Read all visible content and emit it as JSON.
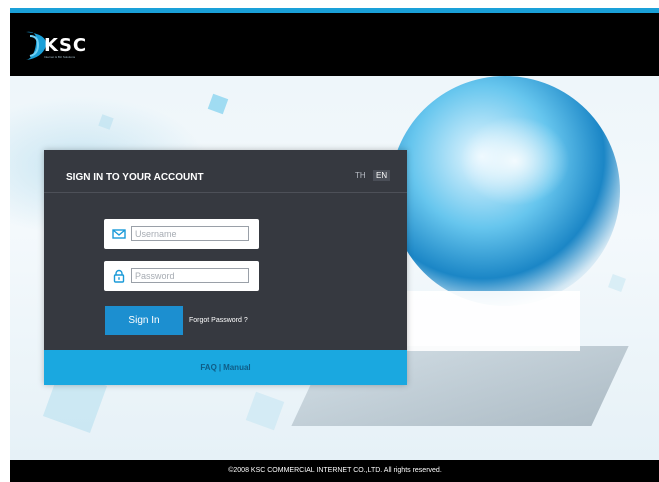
{
  "brand": {
    "logo_text": "KSC",
    "logo_tagline": "Internet & Biz Solutions",
    "accent": "#1aa0d8"
  },
  "login": {
    "title": "SIGN IN TO YOUR ACCOUNT",
    "lang_th": "TH",
    "lang_en": "EN",
    "username_placeholder": "Username",
    "password_placeholder": "Password",
    "signin_label": "Sign In",
    "forgot_label": "Forgot Password ?",
    "faq_label": "FAQ",
    "separator": "|",
    "manual_label": "Manual"
  },
  "footer": {
    "copyright": "©2008 KSC COMMERCIAL INTERNET CO.,LTD. All rights reserved."
  },
  "icons": {
    "username": "envelope-icon",
    "password": "lock-icon"
  }
}
